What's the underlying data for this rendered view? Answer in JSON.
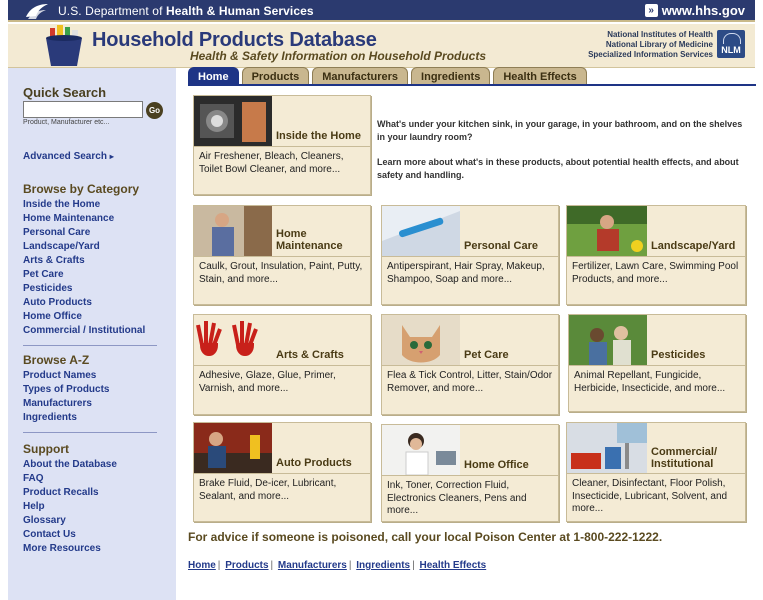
{
  "hhs": {
    "dept_prefix": "U.S. Department of ",
    "dept_bold": "Health & Human Services",
    "url": "www.hhs.gov"
  },
  "header": {
    "title": "Household Products Database",
    "subtitle": "Health & Safety Information on Household Products",
    "nih_line1": "National Institutes of Health",
    "nih_line2": "National Library of Medicine",
    "nih_line3": "Specialized Information Services",
    "nlm": "NLM"
  },
  "sidebar": {
    "quick_search_title": "Quick Search",
    "search_value": "",
    "go_label": "Go",
    "search_hint": "Product, Manufacturer etc...",
    "advanced_search": "Advanced Search",
    "category_title": "Browse by Category",
    "categories": [
      "Inside the Home",
      "Home Maintenance",
      "Personal Care",
      "Landscape/Yard",
      "Arts & Crafts",
      "Pet Care",
      "Pesticides",
      "Auto Products",
      "Home Office",
      "Commercial / Institutional"
    ],
    "az_title": "Browse A-Z",
    "az": [
      "Product Names",
      "Types of Products",
      "Manufacturers",
      "Ingredients"
    ],
    "support_title": "Support",
    "support": [
      "About the Database",
      "FAQ",
      "Product Recalls",
      "Help",
      "Glossary",
      "Contact Us",
      "More Resources"
    ]
  },
  "tabs": [
    "Home",
    "Products",
    "Manufacturers",
    "Ingredients",
    "Health Effects"
  ],
  "intro": {
    "p1": "What's under your kitchen sink, in your garage, in your bathroom, and on the shelves in your laundry room?",
    "p2": "Learn more about what's in these products, about potential health effects, and about safety and handling."
  },
  "cards": {
    "inside_home": {
      "title": "Inside the Home",
      "desc": "Air Freshener, Bleach, Cleaners, Toilet Bowl Cleaner, and more..."
    },
    "home_maintenance": {
      "title": "Home Maintenance",
      "desc": "Caulk, Grout, Insulation, Paint, Putty, Stain, and more..."
    },
    "personal_care": {
      "title": "Personal Care",
      "desc": "Antiperspirant, Hair Spray, Makeup, Shampoo, Soap and more..."
    },
    "landscape_yard": {
      "title": "Landscape/Yard",
      "desc": "Fertilizer, Lawn Care, Swimming Pool Products, and more..."
    },
    "arts_crafts": {
      "title": "Arts & Crafts",
      "desc": "Adhesive, Glaze, Glue, Primer, Varnish, and more..."
    },
    "pet_care": {
      "title": "Pet Care",
      "desc": "Flea & Tick Control, Litter, Stain/Odor Remover, and more..."
    },
    "pesticides": {
      "title": "Pesticides",
      "desc": "Animal Repellant, Fungicide, Herbicide, Insecticide, and more..."
    },
    "auto_products": {
      "title": "Auto Products",
      "desc": "Brake Fluid, De-icer, Lubricant, Sealant, and more..."
    },
    "home_office": {
      "title": "Home Office",
      "desc": "Ink, Toner, Correction Fluid, Electronics Cleaners, Pens and more..."
    },
    "commercial": {
      "title_line1": "Commercial/",
      "title_line2": "Institutional",
      "desc": "Cleaner, Disinfectant, Floor Polish, Insecticide, Lubricant, Solvent, and more..."
    }
  },
  "advice": "For advice if someone is poisoned, call your local Poison Center at 1-800-222-1222.",
  "footer_links": [
    "Home",
    "Products",
    "Manufacturers",
    "Ingredients",
    "Health Effects"
  ],
  "colors": {
    "navy": "#1e3486",
    "tan": "#f4ebd5",
    "sidebar": "#dde2f4",
    "brown": "#5a4a20"
  }
}
